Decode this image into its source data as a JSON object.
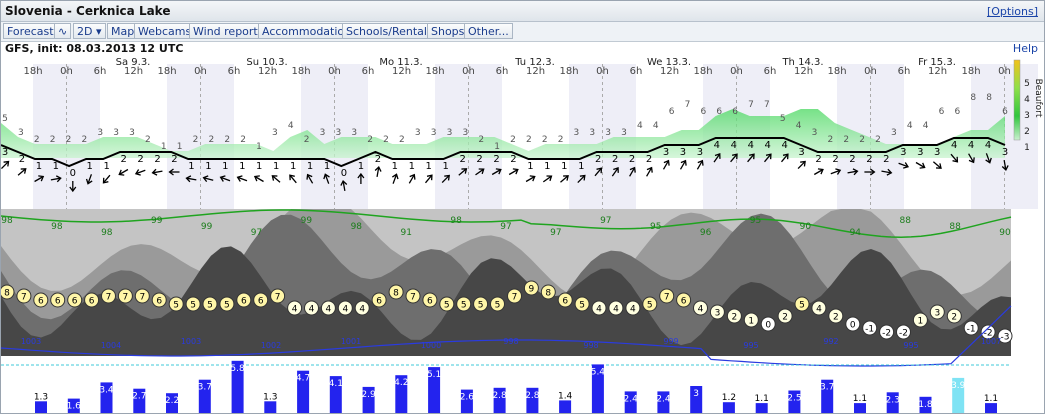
{
  "title": "Slovenia - Cerknica Lake",
  "options_label": "[Options]",
  "menu": [
    "Forecast",
    "∿",
    "2D ▾",
    "Map",
    "Webcams",
    "Wind reports",
    "Accommodation",
    "Schools/Rentals",
    "Shops",
    "Other..."
  ],
  "model_info": "GFS, init: 08.03.2013 12 UTC",
  "help_label": "Help",
  "beaufort_label": "Beaufort",
  "beaufort_scale": [
    "5",
    "4",
    "3",
    "2",
    "1"
  ],
  "colors": {
    "wind_fill": "#62e072",
    "wind_fill_light": "#bff1c6",
    "humidity": "#1fa41f",
    "pressure": "#2a3be0",
    "rain": "#2323ee",
    "snow": "#7fe3f4",
    "cloud_dark": "#474747"
  },
  "chart_data": {
    "type": "area",
    "days": [
      {
        "label": "Sa 9.3."
      },
      {
        "label": "Su 10.3."
      },
      {
        "label": "Mo 11.3."
      },
      {
        "label": "Tu 12.3."
      },
      {
        "label": "We 13.3."
      },
      {
        "label": "Th 14.3."
      },
      {
        "label": "Fr 15.3."
      }
    ],
    "hour_ticks": [
      "18h",
      "0h",
      "6h",
      "12h",
      "18h",
      "0h",
      "6h",
      "12h",
      "18h",
      "0h",
      "6h",
      "12h",
      "18h",
      "0h",
      "6h",
      "12h",
      "18h",
      "0h",
      "6h",
      "12h",
      "18h",
      "0h",
      "6h",
      "12h",
      "18h",
      "0h",
      "6h",
      "12h",
      "18h",
      "0h",
      "6h",
      "12h",
      "18h",
      "0h",
      "6h",
      "12h",
      "18h",
      "0h",
      "6h",
      "12h",
      "18h",
      "0h",
      "6h",
      "12h",
      "18h",
      "0h",
      "6h",
      "12h",
      "18h",
      "0h",
      "6h",
      "12h",
      "18h",
      "0h",
      "6h",
      "12h",
      "18h",
      "0h",
      "6h",
      "12h",
      "18h",
      "0h",
      "6h",
      "12h",
      "18h",
      "0h",
      "6h",
      "12h",
      "18h",
      "0h",
      "6h",
      "12h",
      "18h",
      "0h",
      "6h",
      "12h",
      "18h",
      "0h",
      "6h",
      "12h",
      "18h",
      "0h",
      "6h",
      "12h",
      "18h",
      "0h",
      "6h",
      "12h",
      "18h",
      "0h",
      "6h",
      "12h",
      "18h",
      "0h",
      "6h",
      "12h"
    ],
    "gusts": [
      "5",
      "3",
      "2",
      "2",
      "2",
      "2",
      "3",
      "3",
      "3",
      "2",
      "1",
      "1",
      "2",
      "2",
      "2",
      "2",
      "1",
      "3",
      "4",
      "2",
      "3",
      "3",
      "3",
      "2",
      "2",
      "2",
      "3",
      "3",
      "3",
      "3",
      "2",
      "1",
      "2",
      "2",
      "2",
      "2",
      "3",
      "3",
      "3",
      "3",
      "4",
      "4",
      "6",
      "7",
      "6",
      "6",
      "6",
      "7",
      "7",
      "5",
      "4",
      "3",
      "2",
      "2",
      "2",
      "2",
      "3",
      "4",
      "4",
      "6",
      "6",
      "8",
      "8",
      "6"
    ],
    "wind_speed": [
      "3",
      "2",
      "1",
      "1",
      "0",
      "1",
      "1",
      "2",
      "2",
      "2",
      "2",
      "1",
      "1",
      "1",
      "1",
      "1",
      "1",
      "1",
      "1",
      "1",
      "0",
      "1",
      "2",
      "1",
      "1",
      "1",
      "1",
      "2",
      "2",
      "2",
      "2",
      "1",
      "1",
      "1",
      "1",
      "2",
      "2",
      "2",
      "2",
      "3",
      "3",
      "3",
      "4",
      "4",
      "4",
      "4",
      "4",
      "3",
      "2",
      "2",
      "2",
      "2",
      "2",
      "3",
      "3",
      "3",
      "4",
      "4",
      "4",
      "3"
    ],
    "wind_arrows": [
      45,
      50,
      60,
      80,
      180,
      200,
      220,
      240,
      250,
      260,
      270,
      280,
      285,
      290,
      290,
      300,
      310,
      320,
      330,
      340,
      350,
      0,
      10,
      20,
      30,
      40,
      45,
      50,
      55,
      60,
      60,
      60,
      55,
      50,
      45,
      40,
      35,
      30,
      30,
      30,
      30,
      30,
      35,
      40,
      40,
      40,
      40,
      45,
      60,
      70,
      80,
      90,
      100,
      110,
      120,
      130,
      140,
      150,
      160,
      170
    ],
    "humidity_labels": [
      "98",
      "98",
      "98",
      "99",
      "99",
      "97",
      "99",
      "98",
      "91",
      "98",
      "97",
      "97",
      "97",
      "95",
      "96",
      "95",
      "90",
      "94",
      "88",
      "88",
      "90"
    ],
    "cloud_cover_bands": [
      "high",
      "mid",
      "low"
    ],
    "temperature": [
      "8",
      "7",
      "6",
      "6",
      "6",
      "6",
      "7",
      "7",
      "7",
      "6",
      "5",
      "5",
      "5",
      "5",
      "6",
      "6",
      "7",
      "4",
      "4",
      "4",
      "4",
      "4",
      "6",
      "8",
      "7",
      "6",
      "5",
      "5",
      "5",
      "5",
      "7",
      "9",
      "8",
      "6",
      "5",
      "4",
      "4",
      "4",
      "5",
      "7",
      "6",
      "4",
      "3",
      "2",
      "1",
      "0",
      "2",
      "5",
      "4",
      "2",
      "0",
      "-1",
      "-2",
      "-2",
      "1",
      "3",
      "2",
      "-1",
      "-2",
      "-3"
    ],
    "pressure_labels": [
      "1003",
      "1004",
      "1003",
      "1002",
      "1001",
      "1000",
      "998",
      "998",
      "999",
      "995",
      "992",
      "995",
      "1007"
    ],
    "precip": [
      "1.3",
      "1.6",
      "3.4",
      "2.7",
      "2.2",
      "3.7",
      "5.8",
      "1.3",
      "4.7",
      "4.1",
      "2.9",
      "4.2",
      "5.1",
      "2.6",
      "2.8",
      "2.8",
      "1.4",
      "5.4",
      "2.4",
      "2.4",
      "3",
      "1.2",
      "1.1",
      "2.5",
      "3.7",
      "1.1",
      "2.3",
      "1.8",
      "3.9",
      "1.1"
    ]
  }
}
